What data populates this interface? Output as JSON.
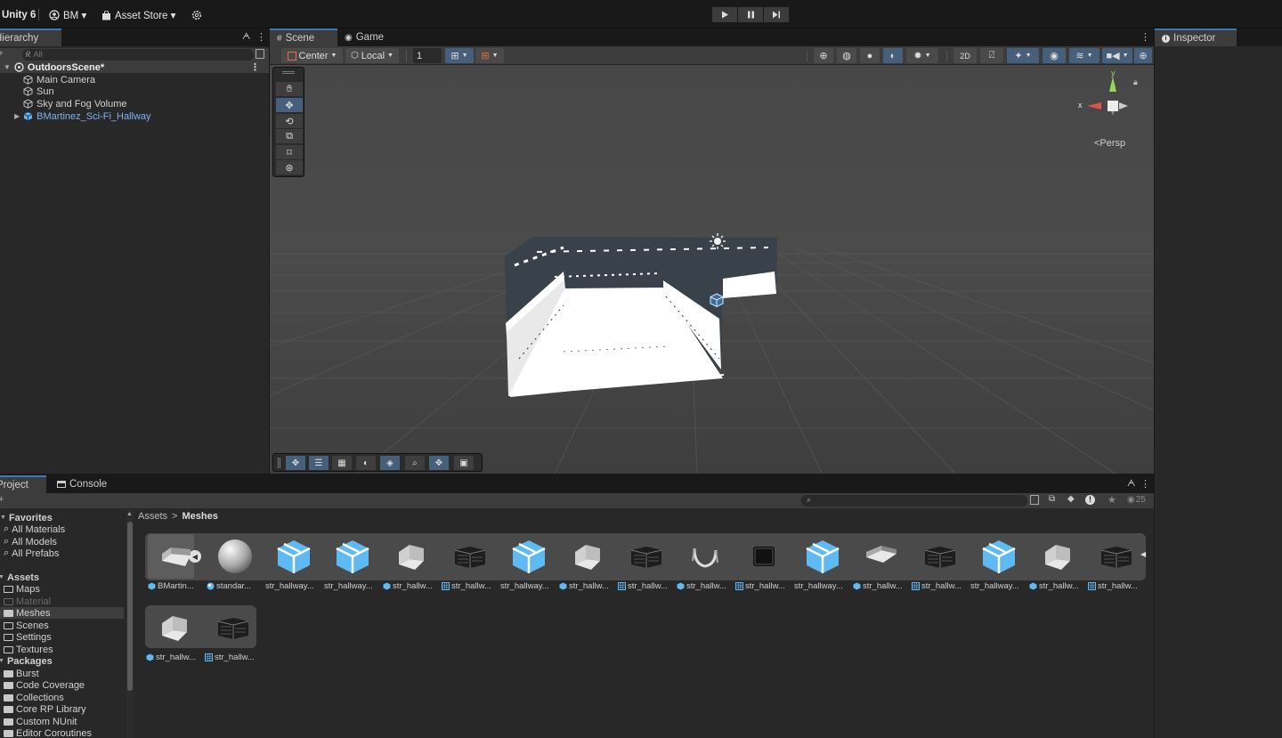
{
  "topbar": {
    "app": "Unity 6",
    "account": "BM ▾",
    "store": "Asset Store ▾",
    "play_icons": [
      "play-icon",
      "pause-icon",
      "step-icon"
    ]
  },
  "hierarchy": {
    "tab": "Hierarchy",
    "search_placeholder": "All",
    "scene": "OutdoorsScene*",
    "items": [
      "Main Camera",
      "Sun",
      "Sky and Fog Volume",
      "BMartinez_Sci-Fi_Hallway"
    ]
  },
  "scene_view": {
    "tabs": [
      "Scene",
      "Game"
    ],
    "pivot": "Center",
    "space": "Local",
    "grid_snap": "1",
    "persp": "<Persp",
    "gizmo_x": "x",
    "gizmo_y": "y"
  },
  "inspector": {
    "tab": "Inspector"
  },
  "project": {
    "tabs": [
      "Project",
      "Console"
    ],
    "breadcrumb_root": "Assets",
    "breadcrumb_sep": ">",
    "breadcrumb_current": "Meshes",
    "visibility_count": "25",
    "favorites_title": "Favorites",
    "favorites": [
      "All Materials",
      "All Models",
      "All Prefabs"
    ],
    "assets_title": "Assets",
    "asset_folders": [
      "Maps",
      "Material",
      "Meshes",
      "Scenes",
      "Settings",
      "Textures"
    ],
    "packages_title": "Packages",
    "packages": [
      "Burst",
      "Code Coverage",
      "Collections",
      "Core RP Library",
      "Custom NUnit",
      "Editor Coroutines"
    ],
    "assets_row1": [
      "BMartin...",
      "standar...",
      "str_hallway...",
      "str_hallway...",
      "str_hallw...",
      "str_hallw...",
      "str_hallway...",
      "str_hallw...",
      "str_hallw...",
      "str_hallw...",
      "str_hallw...",
      "str_hallway...",
      "str_hallw...",
      "str_hallw...",
      "str_hallway...",
      "str_hallw...",
      "str_hallw..."
    ],
    "assets_row2": [
      "str_hallw...",
      "str_hallw..."
    ]
  }
}
